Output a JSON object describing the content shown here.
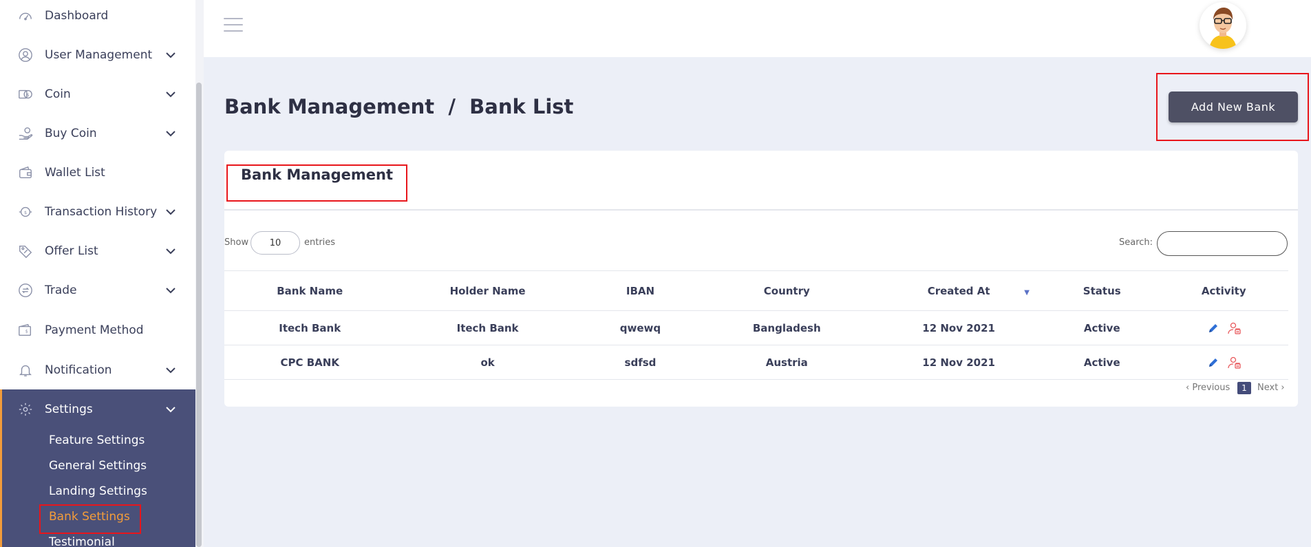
{
  "sidebar": {
    "items": [
      {
        "label": "Dashboard",
        "icon": "dashboard-icon",
        "has_chevron": false
      },
      {
        "label": "User Management",
        "icon": "user-circle-icon",
        "has_chevron": true
      },
      {
        "label": "Coin",
        "icon": "coin-icon",
        "has_chevron": true
      },
      {
        "label": "Buy Coin",
        "icon": "hand-coin-icon",
        "has_chevron": true
      },
      {
        "label": "Wallet List",
        "icon": "wallet-icon",
        "has_chevron": false
      },
      {
        "label": "Transaction History",
        "icon": "exchange-icon",
        "has_chevron": true
      },
      {
        "label": "Offer List",
        "icon": "tag-icon",
        "has_chevron": true
      },
      {
        "label": "Trade",
        "icon": "trade-icon",
        "has_chevron": true
      },
      {
        "label": "Payment Method",
        "icon": "payment-icon",
        "has_chevron": false
      },
      {
        "label": "Notification",
        "icon": "bell-icon",
        "has_chevron": true
      },
      {
        "label": "Settings",
        "icon": "gear-icon",
        "has_chevron": true
      }
    ],
    "settings_sub": [
      {
        "label": "Feature Settings"
      },
      {
        "label": "General Settings"
      },
      {
        "label": "Landing Settings"
      },
      {
        "label": "Bank Settings",
        "active": true
      },
      {
        "label": "Testimonial"
      }
    ]
  },
  "header": {
    "breadcrumb": "Bank Management  /  Bank List",
    "add_button": "Add New Bank"
  },
  "card": {
    "title": "Bank Management",
    "show_label": "Show",
    "entries_value": "10",
    "entries_label": "entries",
    "search_label": "Search:",
    "search_value": ""
  },
  "table": {
    "columns": [
      "Bank Name",
      "Holder Name",
      "IBAN",
      "Country",
      "Created At",
      "Status",
      "Activity"
    ],
    "rows": [
      {
        "bank_name": "Itech Bank",
        "holder_name": "Itech Bank",
        "iban": "qwewq",
        "country": "Bangladesh",
        "created_at": "12 Nov 2021",
        "status": "Active"
      },
      {
        "bank_name": "CPC BANK",
        "holder_name": "ok",
        "iban": "sdfsd",
        "country": "Austria",
        "created_at": "12 Nov 2021",
        "status": "Active"
      }
    ]
  },
  "pagination": {
    "previous": "‹ Previous",
    "current": "1",
    "next": "Next ›"
  },
  "colors": {
    "accent": "#F39C3A",
    "sidebar_active_bg": "#4A5079",
    "button_bg": "#4E5064",
    "highlight_border": "#E8151B",
    "edit_icon": "#2F6FD6",
    "delete_icon": "#E8595C"
  }
}
